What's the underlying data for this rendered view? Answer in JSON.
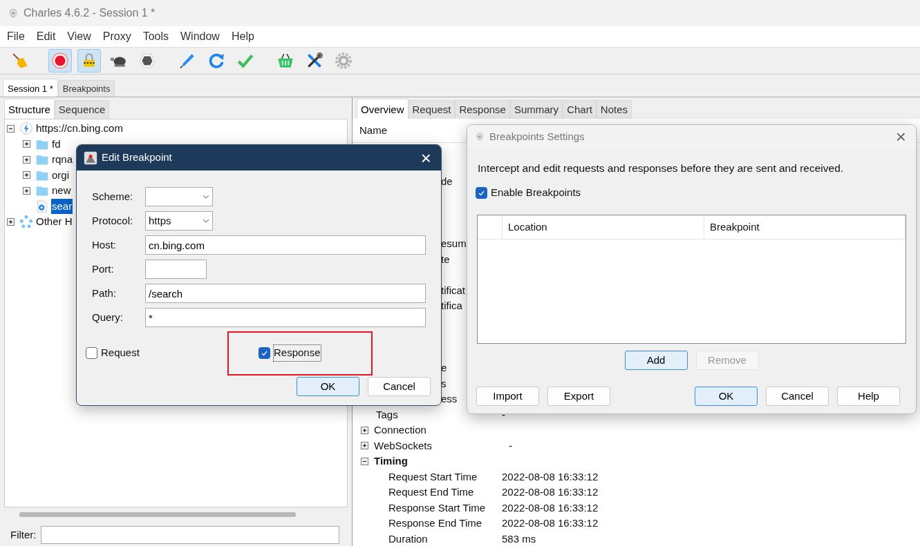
{
  "window": {
    "title": "Charles 4.6.2 - Session 1 *"
  },
  "menu": [
    "File",
    "Edit",
    "View",
    "Proxy",
    "Tools",
    "Window",
    "Help"
  ],
  "toolbar": [
    {
      "kind": "broom",
      "pressed": false
    },
    {
      "kind": "record",
      "pressed": true
    },
    {
      "kind": "lock",
      "pressed": true
    },
    {
      "kind": "turtle",
      "pressed": false
    },
    {
      "kind": "stop",
      "pressed": false
    },
    {
      "kind": "pen",
      "pressed": false
    },
    {
      "kind": "refresh",
      "pressed": false
    },
    {
      "kind": "check",
      "pressed": false
    },
    {
      "kind": "basket",
      "pressed": false
    },
    {
      "kind": "tools",
      "pressed": false
    },
    {
      "kind": "gear",
      "pressed": false
    }
  ],
  "session_tabs": [
    {
      "label": "Session 1 *",
      "selected": true
    },
    {
      "label": "Breakpoints",
      "selected": false
    }
  ],
  "left_tabs": [
    {
      "label": "Structure",
      "selected": true
    },
    {
      "label": "Sequence",
      "selected": false
    }
  ],
  "tree": [
    {
      "label": "https://cn.bing.com",
      "kind": "host",
      "expanded": true,
      "selected": false,
      "children": [
        {
          "label": "fd",
          "kind": "folder",
          "expanded": false,
          "selected": false
        },
        {
          "label": "rqna",
          "kind": "folder",
          "expanded": false,
          "selected": false
        },
        {
          "label": "orgi",
          "kind": "folder",
          "expanded": false,
          "selected": false
        },
        {
          "label": "new",
          "kind": "folder",
          "expanded": false,
          "selected": false
        },
        {
          "label": "sear",
          "kind": "file",
          "selected": true
        }
      ]
    },
    {
      "label": "Other H",
      "kind": "hosts",
      "expanded": false,
      "selected": false
    }
  ],
  "filter": {
    "label": "Filter:"
  },
  "right_tabs": [
    {
      "label": "Overview",
      "selected": true
    },
    {
      "label": "Request",
      "selected": false
    },
    {
      "label": "Response",
      "selected": false
    },
    {
      "label": "Summary",
      "selected": false
    },
    {
      "label": "Chart",
      "selected": false
    },
    {
      "label": "Notes",
      "selected": false
    }
  ],
  "overview": {
    "header": "Name",
    "rows": [
      {
        "kind": "covered",
        "label": "de"
      },
      {
        "kind": "covered",
        "label": "esum"
      },
      {
        "kind": "covered",
        "label": "te"
      },
      {
        "kind": "covered",
        "label": "tificat"
      },
      {
        "kind": "covered",
        "label": "tifica"
      },
      {
        "kind": "covered",
        "label": "e"
      },
      {
        "kind": "covered",
        "label": "s"
      },
      {
        "kind": "covered",
        "label": "ess"
      },
      {
        "kind": "field",
        "label": "Tags",
        "value": "-"
      },
      {
        "kind": "group",
        "label": "Connection",
        "expanded": false
      },
      {
        "kind": "group",
        "label": "WebSockets",
        "expanded": false,
        "value": "-"
      },
      {
        "kind": "group",
        "label": "Timing",
        "expanded": true,
        "children": [
          {
            "label": "Request Start Time",
            "value": "2022-08-08 16:33:12"
          },
          {
            "label": "Request End Time",
            "value": "2022-08-08 16:33:12"
          },
          {
            "label": "Response Start Time",
            "value": "2022-08-08 16:33:12"
          },
          {
            "label": "Response End Time",
            "value": "2022-08-08 16:33:12"
          },
          {
            "label": "Duration",
            "value": "583 ms"
          }
        ]
      }
    ]
  },
  "edit_dialog": {
    "title": "Edit Breakpoint",
    "close": "×",
    "fields": [
      {
        "label": "Scheme:",
        "kind": "select"
      },
      {
        "label": "Protocol:",
        "kind": "select",
        "value": "https"
      },
      {
        "label": "Host:",
        "kind": "text",
        "value": "cn.bing.com"
      },
      {
        "label": "Port:",
        "kind": "short"
      },
      {
        "label": "Path:",
        "kind": "text",
        "value": "/search"
      },
      {
        "label": "Query:",
        "kind": "text",
        "value": "*"
      }
    ],
    "checkboxes": [
      {
        "label": "Request",
        "checked": false,
        "highlighted": false
      },
      {
        "label": "Response",
        "checked": true,
        "highlighted": true
      }
    ],
    "buttons": [
      {
        "label": "OK",
        "default": true
      },
      {
        "label": "Cancel",
        "default": false
      }
    ]
  },
  "settings_dialog": {
    "title": "Breakpoints Settings",
    "close": "×",
    "description": "Intercept and edit requests and responses before they are sent and received.",
    "enable": {
      "label": "Enable Breakpoints",
      "checked": true
    },
    "columns": [
      "Location",
      "Breakpoint"
    ],
    "table_buttons": [
      {
        "label": "Add",
        "default": true,
        "disabled": false
      },
      {
        "label": "Remove",
        "default": false,
        "disabled": true
      }
    ],
    "left_buttons": [
      {
        "label": "Import",
        "default": false
      },
      {
        "label": "Export",
        "default": false
      }
    ],
    "buttons": [
      {
        "label": "OK",
        "default": true
      },
      {
        "label": "Cancel",
        "default": false
      },
      {
        "label": "Help",
        "default": false
      }
    ]
  }
}
